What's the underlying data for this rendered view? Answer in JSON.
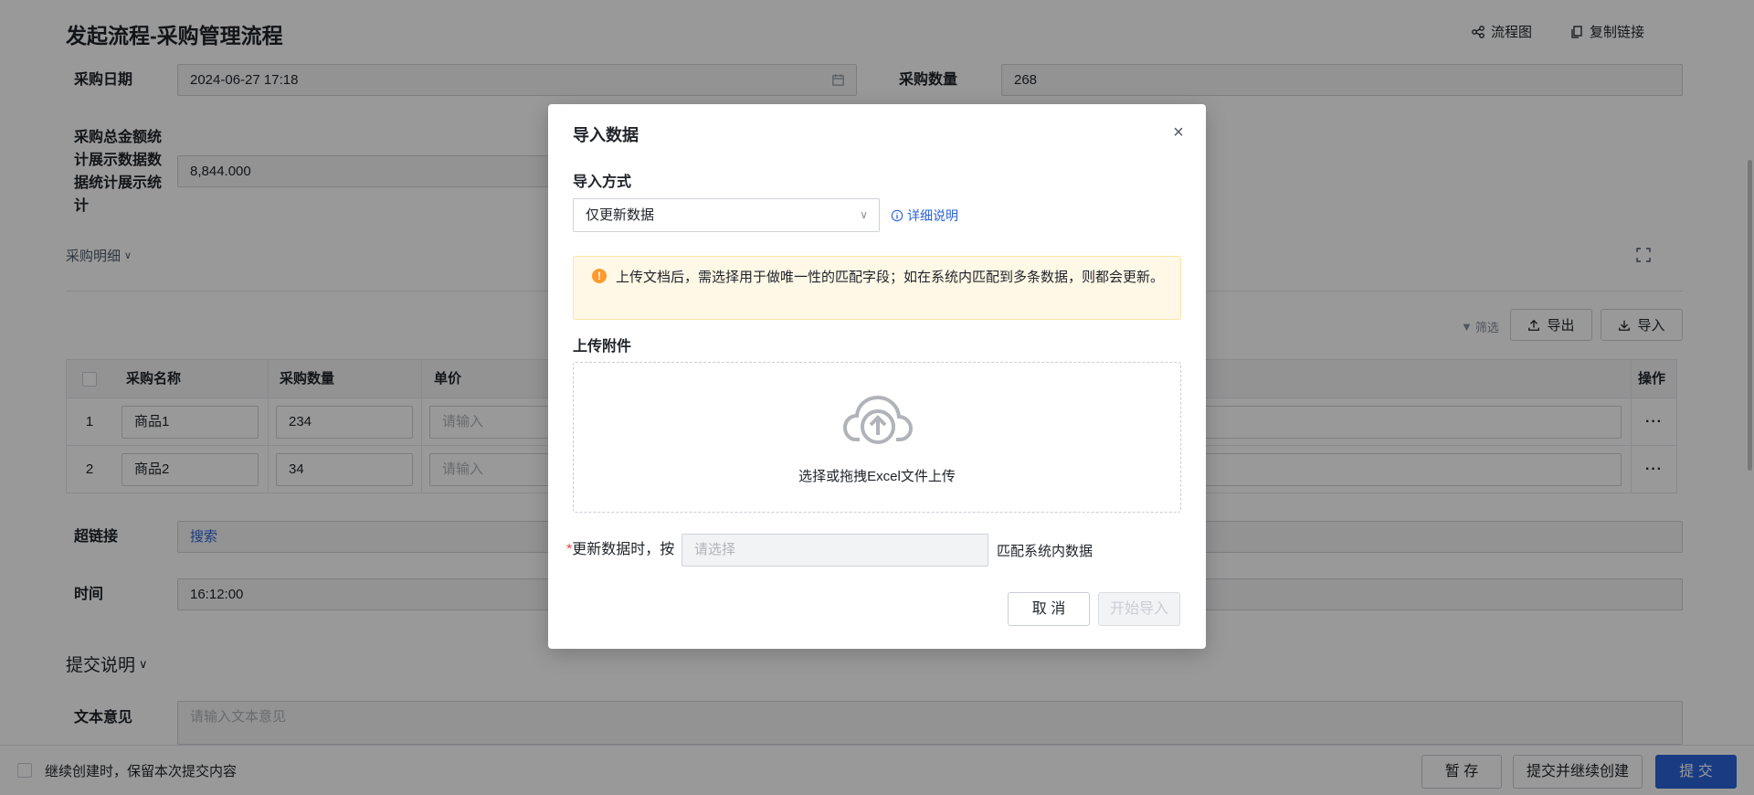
{
  "header": {
    "title": "发起流程-采购管理流程",
    "flowchart_label": "流程图",
    "copy_link_label": "复制链接"
  },
  "form": {
    "purchase_date_label": "采购日期",
    "purchase_date_value": "2024-06-27 17:18",
    "purchase_qty_label": "采购数量",
    "purchase_qty_value": "268",
    "total_amount_label": "采购总金额统计展示数据数据统计展示统计",
    "total_amount_value": "8,844.000",
    "detail_section_label": "采购明细",
    "hyperlink_label": "超链接",
    "hyperlink_value": "搜索",
    "time_label": "时间",
    "time_value": "16:12:00",
    "submit_note_section": "提交说明",
    "text_opinion_label": "文本意见",
    "text_opinion_placeholder": "请输入文本意见"
  },
  "table_toolbar": {
    "filter_label": "筛选",
    "export_label": "导出",
    "import_label": "导入"
  },
  "table": {
    "columns": [
      "采购名称",
      "采购数量",
      "单价",
      "操作"
    ],
    "rows": [
      {
        "index": "1",
        "name": "商品1",
        "qty": "234",
        "price_placeholder": "请输入",
        "more": "···"
      },
      {
        "index": "2",
        "name": "商品2",
        "qty": "34",
        "price_placeholder": "请输入",
        "more": "···"
      }
    ]
  },
  "footer": {
    "keep_content_label": "继续创建时，保留本次提交内容",
    "save_draft": "暂 存",
    "submit_continue": "提交并继续创建",
    "submit": "提 交"
  },
  "modal": {
    "title": "导入数据",
    "close_symbol": "×",
    "import_mode_label": "导入方式",
    "import_mode_value": "仅更新数据",
    "details_link": "详细说明",
    "alert_icon_text": "!",
    "alert_text": "上传文档后，需选择用于做唯一性的匹配字段；如在系统内匹配到多条数据，则都会更新。",
    "attachment_label": "上传附件",
    "upload_text": "选择或拖拽Excel文件上传",
    "match_required_mark": "*",
    "match_prefix": "更新数据时，按",
    "match_placeholder": "请选择",
    "match_suffix": "匹配系统内数据",
    "cancel_button": "取 消",
    "start_import_button": "开始导入"
  },
  "colors": {
    "primary": "#2b63d9",
    "warning": "#ff9a2e",
    "alert_bg": "#fff8e6",
    "overlay": "rgba(0,0,0,0.40)"
  },
  "icons": [
    "flowchart-icon",
    "copy-icon",
    "calendar-icon",
    "chevron-down-icon",
    "expand-icon",
    "filter-icon",
    "export-icon",
    "import-icon",
    "close-icon",
    "info-icon",
    "warning-icon",
    "cloud-upload-icon"
  ]
}
